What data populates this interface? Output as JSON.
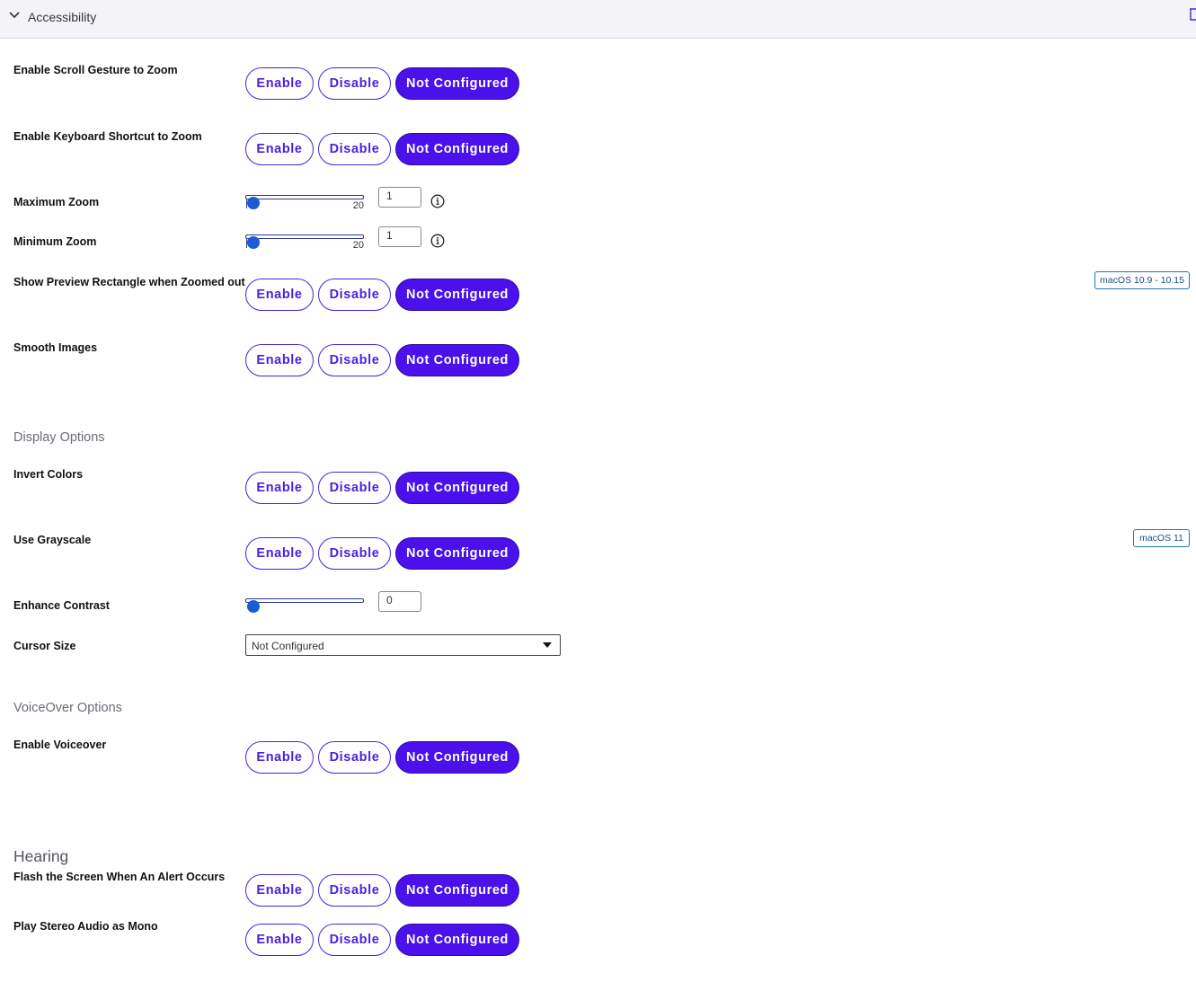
{
  "header": {
    "title": "Accessibility"
  },
  "buttons": {
    "enable": "Enable",
    "disable": "Disable",
    "not_configured": "Not Configured"
  },
  "settings": {
    "scroll_gesture": "Enable Scroll Gesture to Zoom",
    "keyboard_shortcut": "Enable Keyboard Shortcut to Zoom",
    "maximum_zoom": {
      "label": "Maximum Zoom",
      "slider_max": "20",
      "value": "1"
    },
    "minimum_zoom": {
      "label": "Minimum Zoom",
      "slider_max": "20",
      "value": "1"
    },
    "preview_rectangle": {
      "label": "Show Preview Rectangle when Zoomed out",
      "badge": "macOS 10.9 - 10.15"
    },
    "smooth_images": "Smooth Images",
    "invert_colors": "Invert Colors",
    "use_grayscale": {
      "label": "Use Grayscale",
      "badge": "macOS 11"
    },
    "enhance_contrast": {
      "label": "Enhance Contrast",
      "value": "0"
    },
    "cursor_size": {
      "label": "Cursor Size",
      "selected": "Not Configured"
    },
    "enable_voiceover": "Enable Voiceover",
    "flash_screen": "Flash the Screen When An Alert Occurs",
    "stereo_mono": "Play Stereo Audio as Mono"
  },
  "sections": {
    "display_options": "Display Options",
    "voiceover_options": "VoiceOver Options",
    "hearing": "Hearing"
  },
  "colors": {
    "accent": "#4a11ec",
    "slider_thumb": "#1a5cd6",
    "badge_border": "#1f74b8"
  }
}
